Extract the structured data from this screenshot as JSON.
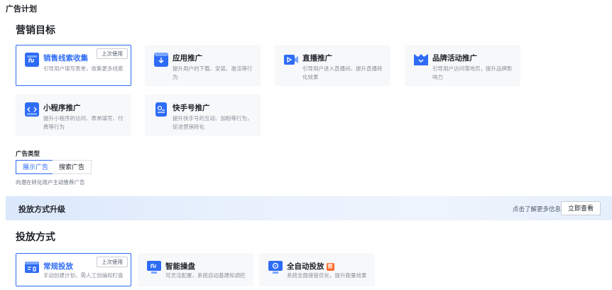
{
  "page": {
    "title": "广告计划"
  },
  "marketing": {
    "title": "营销目标",
    "recent_badge": "上次使用",
    "items": [
      {
        "name": "销售线索收集",
        "desc": "引导用户填写表单，收集更多线索"
      },
      {
        "name": "应用推广",
        "desc": "提升用户的下载、安装、激活等行为"
      },
      {
        "name": "直播推广",
        "desc": "引导用户进入直播间，提升直播转化效果"
      },
      {
        "name": "品牌活动推广",
        "desc": "引导用户访问落地页，提升品牌影响力"
      },
      {
        "name": "小程序推广",
        "desc": "提升小程序的访问、表单填写、付费等行为"
      },
      {
        "name": "快手号推广",
        "desc": "提升快手号的互动、加粉等行为，促进营销转化"
      }
    ]
  },
  "ad_type": {
    "label": "广告类型",
    "options": [
      "展示广告",
      "搜索广告"
    ],
    "selected": "展示广告",
    "note": "向潜在转化用户主动推荐广告"
  },
  "banner": {
    "title": "投放方式升级",
    "hint": "点击了解更多信息",
    "button": "立即查看"
  },
  "delivery": {
    "title": "投放方式",
    "recent_badge": "上次使用",
    "auto_badge": "荐",
    "items": [
      {
        "name": "常规投放",
        "desc": "手动创建计划，需人工创编和盯盘"
      },
      {
        "name": "智能操盘",
        "desc": "可灵活配置，系统自动基建和调控"
      },
      {
        "name": "全自动投放",
        "desc": "系统全面接管优化，提升跑量效果"
      }
    ]
  },
  "colors": {
    "accent": "#2e6cf6",
    "badge_orange": "#ff6a2b"
  }
}
